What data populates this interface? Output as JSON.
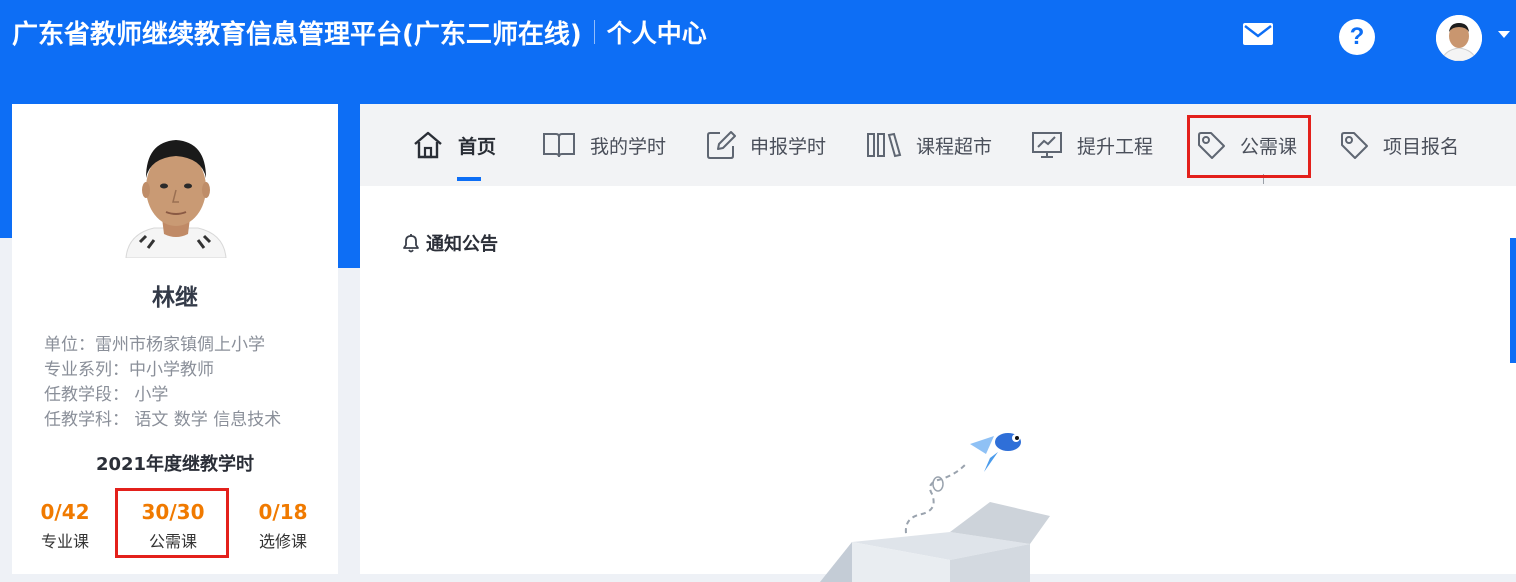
{
  "header": {
    "title": "广东省教师继续教育信息管理平台(广东二师在线)",
    "subtitle": "个人中心",
    "mail_icon": "mail-icon",
    "help_icon": "help-icon",
    "help_glyph": "?",
    "avatar_icon": "avatar"
  },
  "profile": {
    "name": "林继",
    "info": [
      "单位：雷州市杨家镇倜上小学",
      "专业系列：中小学教师",
      "任教学段：  小学",
      "任教学科：  语文  数学  信息技术"
    ],
    "year_title": "2021年度继教学时",
    "stats": [
      {
        "value": "0/42",
        "label": "专业课"
      },
      {
        "value": "30/30",
        "label": "公需课"
      },
      {
        "value": "0/18",
        "label": "选修课"
      }
    ]
  },
  "nav": {
    "items": [
      {
        "label": "首页",
        "icon": "home-icon"
      },
      {
        "label": "我的学时",
        "icon": "book-icon"
      },
      {
        "label": "申报学时",
        "icon": "edit-icon"
      },
      {
        "label": "课程超市",
        "icon": "library-icon"
      },
      {
        "label": "提升工程",
        "icon": "chart-board-icon"
      },
      {
        "label": "公需课",
        "icon": "tag-icon"
      },
      {
        "label": "项目报名",
        "icon": "tag-icon"
      }
    ],
    "active_index": 0
  },
  "notice": {
    "title": "通知公告",
    "icon": "bell-icon"
  },
  "colors": {
    "brand_blue": "#0d6ef5",
    "accent_orange": "#f07a00",
    "highlight_red": "#e3201b"
  }
}
